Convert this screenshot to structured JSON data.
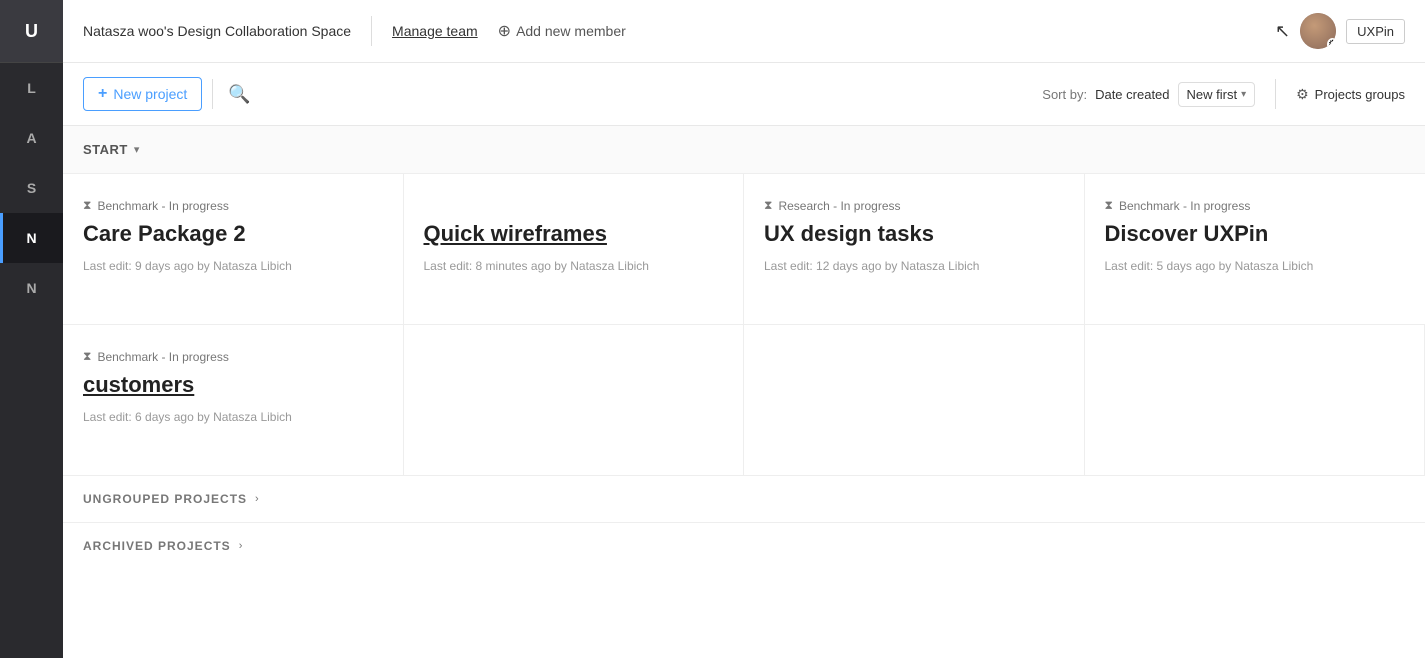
{
  "sidebar": {
    "items": [
      {
        "label": "U",
        "active": false
      },
      {
        "label": "L",
        "active": false
      },
      {
        "label": "A",
        "active": false
      },
      {
        "label": "S",
        "active": false
      },
      {
        "label": "N",
        "active": true
      },
      {
        "label": "N",
        "active": false
      }
    ]
  },
  "header": {
    "title": "Natasza woo's Design Collaboration Space",
    "manage_team": "Manage team",
    "add_member": "Add new member",
    "uxpin_badge": "UXPin"
  },
  "toolbar": {
    "new_project_label": "New project",
    "new_project_plus": "+",
    "sort_label": "Sort by:",
    "sort_by": "Date created",
    "sort_option": "New first",
    "projects_groups": "Projects groups"
  },
  "section": {
    "title": "START",
    "arrow": "▾"
  },
  "projects": [
    {
      "status": "Benchmark - In progress",
      "name": "Care Package 2",
      "name_link": false,
      "edit_info": "Last edit: 9 days ago by Natasza Libich"
    },
    {
      "status": "",
      "name": "Quick wireframes",
      "name_link": true,
      "edit_info": "Last edit: 8 minutes ago by Natasza Libich"
    },
    {
      "status": "Research - In progress",
      "name": "UX design tasks",
      "name_link": false,
      "edit_info": "Last edit: 12 days ago by Natasza Libich"
    },
    {
      "status": "Benchmark - In progress",
      "name": "Discover UXPin",
      "name_link": false,
      "edit_info": "Last edit: 5 days ago by Natasza Libich"
    }
  ],
  "project_second_row": [
    {
      "status": "Benchmark - In progress",
      "name": "customers",
      "name_link": true,
      "edit_info": "Last edit: 6 days ago by Natasza Libich"
    }
  ],
  "bottom_sections": [
    {
      "label": "UNGROUPED PROJECTS",
      "arrow": "›"
    },
    {
      "label": "ARCHIVED PROJECTS",
      "arrow": "›"
    }
  ]
}
